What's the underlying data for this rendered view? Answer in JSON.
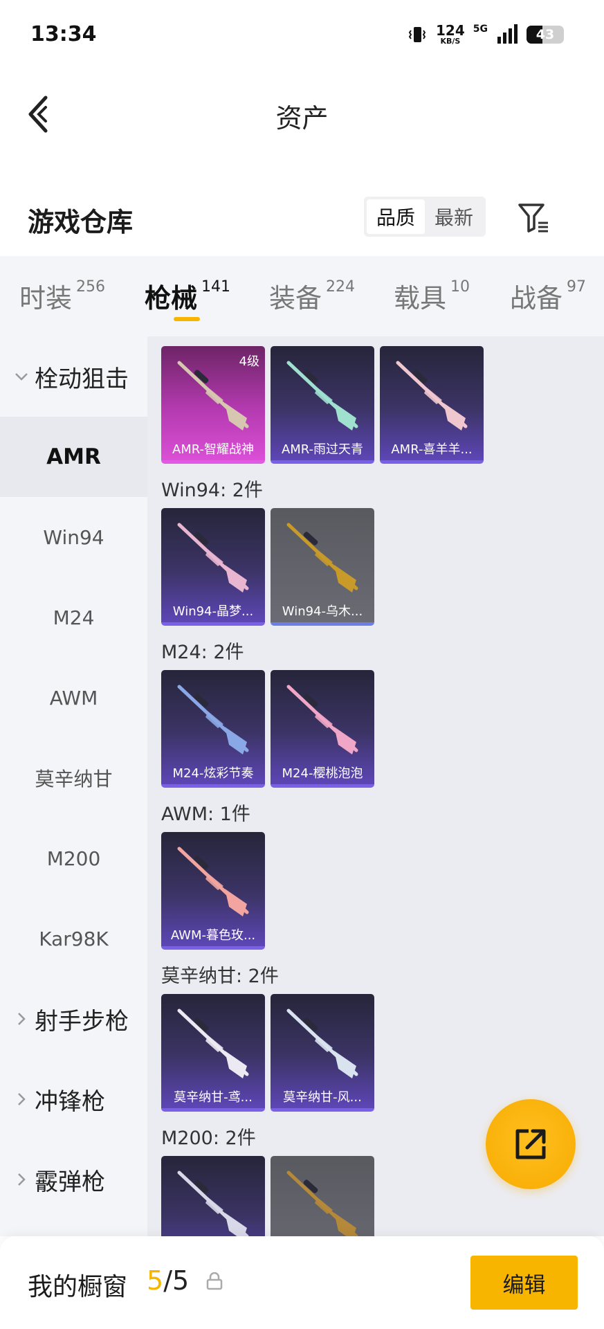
{
  "status_bar": {
    "time": "13:34",
    "net_speed": "124",
    "net_unit": "KB/S",
    "signal": "5G",
    "battery": "43",
    "battery_level": 0.43
  },
  "nav": {
    "title": "资产",
    "back_icon": "chevron-left-icon"
  },
  "header": {
    "title": "游戏仓库",
    "sort": {
      "options": [
        "品质",
        "最新"
      ],
      "selected": "品质"
    },
    "filter_icon": "filter-icon"
  },
  "tabs": [
    {
      "label": "时装",
      "count": "256"
    },
    {
      "label": "枪械",
      "count": "141",
      "active": true
    },
    {
      "label": "装备",
      "count": "224"
    },
    {
      "label": "载具",
      "count": "10"
    },
    {
      "label": "战备",
      "count": "97"
    }
  ],
  "sidebar": {
    "items": [
      {
        "label": "栓动狙击",
        "type": "group",
        "expanded": true
      },
      {
        "label": "AMR",
        "type": "sub",
        "active": true
      },
      {
        "label": "Win94",
        "type": "sub"
      },
      {
        "label": "M24",
        "type": "sub"
      },
      {
        "label": "AWM",
        "type": "sub"
      },
      {
        "label": "莫辛纳甘",
        "type": "sub"
      },
      {
        "label": "M200",
        "type": "sub"
      },
      {
        "label": "Kar98K",
        "type": "sub"
      },
      {
        "label": "射手步枪",
        "type": "group",
        "expanded": false
      },
      {
        "label": "冲锋枪",
        "type": "group",
        "expanded": false
      },
      {
        "label": "霰弹枪",
        "type": "group",
        "expanded": false
      }
    ]
  },
  "sections": [
    {
      "title": "",
      "items": [
        {
          "name": "AMR-智耀战神",
          "rarity": "pink",
          "badge": "4级",
          "gun_color": "#d7c7b0"
        },
        {
          "name": "AMR-雨过天青",
          "rarity": "purple",
          "gun_color": "#9fe0cf"
        },
        {
          "name": "AMR-喜羊羊...",
          "rarity": "purple",
          "gun_color": "#f0c6cf"
        }
      ]
    },
    {
      "title": "Win94: 2件",
      "items": [
        {
          "name": "Win94-晶梦...",
          "rarity": "purple",
          "gun_color": "#e9b6d1"
        },
        {
          "name": "Win94-乌木...",
          "rarity": "gray",
          "gun_color": "#c79a2a"
        }
      ]
    },
    {
      "title": "M24: 2件",
      "items": [
        {
          "name": "M24-炫彩节奏",
          "rarity": "purple",
          "gun_color": "#8aa7e6"
        },
        {
          "name": "M24-樱桃泡泡",
          "rarity": "purple",
          "gun_color": "#f0a6c6"
        }
      ]
    },
    {
      "title": "AWM: 1件",
      "items": [
        {
          "name": "AWM-暮色玫...",
          "rarity": "purple",
          "gun_color": "#f1a4a0"
        }
      ]
    },
    {
      "title": "莫辛纳甘: 2件",
      "items": [
        {
          "name": "莫辛纳甘-鸢...",
          "rarity": "purple",
          "gun_color": "#ece9f2"
        },
        {
          "name": "莫辛纳甘-风...",
          "rarity": "purple",
          "gun_color": "#d9e3f0"
        }
      ]
    },
    {
      "title": "M200: 2件",
      "items": [
        {
          "name": "",
          "rarity": "purple",
          "gun_color": "#d8d8e8"
        },
        {
          "name": "",
          "rarity": "gray",
          "gun_color": "#b5893a"
        }
      ]
    }
  ],
  "fab": {
    "icon": "share-icon"
  },
  "bottom_bar": {
    "title": "我的橱窗",
    "current": "5",
    "total": "5",
    "lock_icon": "lock-icon",
    "edit_label": "编辑"
  }
}
